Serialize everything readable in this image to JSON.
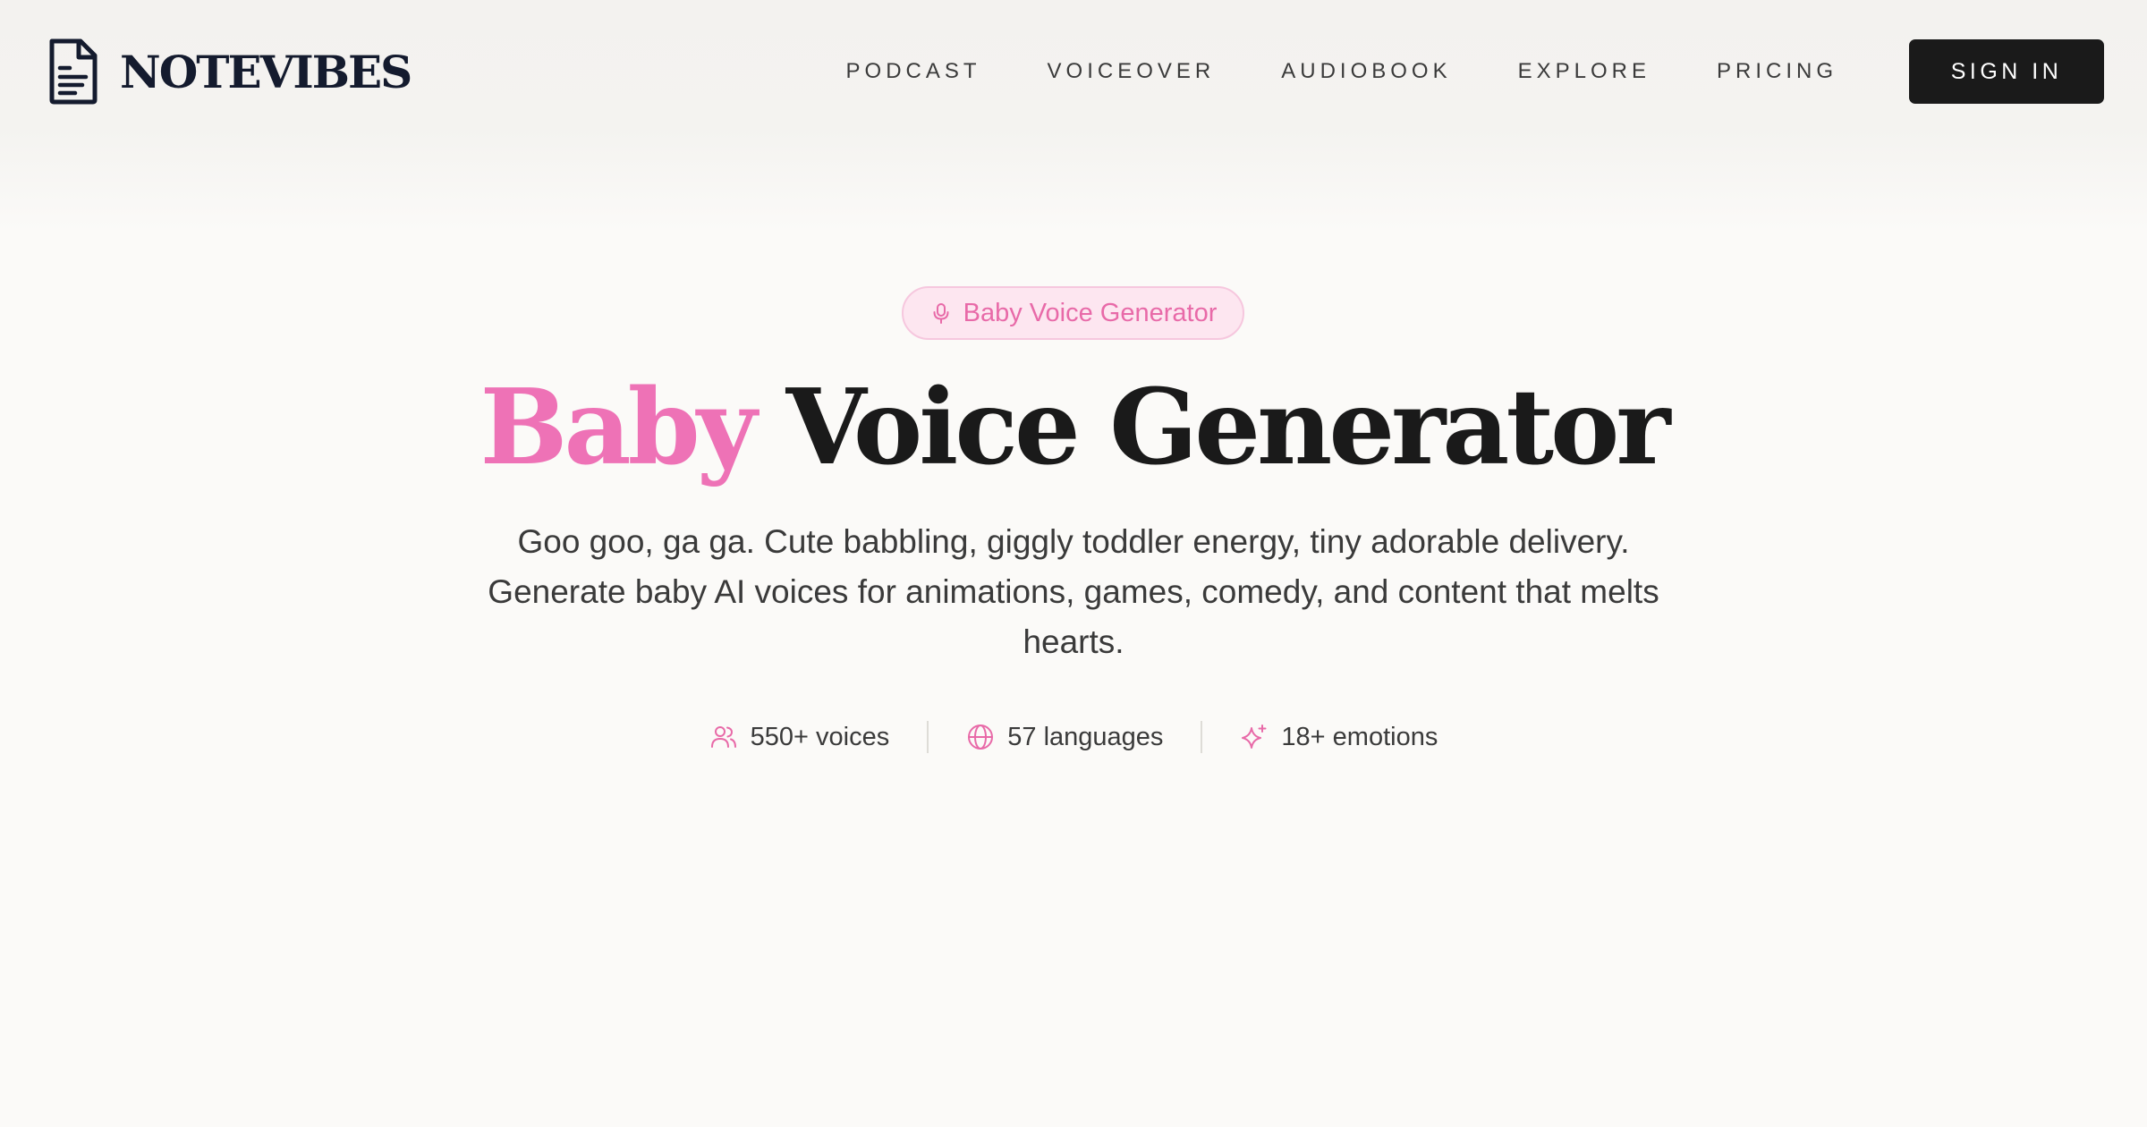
{
  "header": {
    "brand_name": "NOTEVIBES",
    "nav": [
      {
        "label": "PODCAST"
      },
      {
        "label": "VOICEOVER"
      },
      {
        "label": "AUDIOBOOK"
      },
      {
        "label": "EXPLORE"
      },
      {
        "label": "PRICING"
      }
    ],
    "signin_label": "SIGN IN"
  },
  "hero": {
    "badge_label": "Baby Voice Generator",
    "title_accent": "Baby",
    "title_rest": "Voice Generator",
    "subtitle": "Goo goo, ga ga. Cute babbling, giggly toddler energy, tiny adorable delivery. Generate baby AI voices for animations, games, comedy, and content that melts hearts.",
    "stats": [
      {
        "icon": "users-icon",
        "label": "550+ voices"
      },
      {
        "icon": "globe-icon",
        "label": "57 languages"
      },
      {
        "icon": "sparkle-icon",
        "label": "18+ emotions"
      }
    ]
  },
  "colors": {
    "accent_pink": "#ee72b6",
    "badge_bg": "#fde6f0",
    "dark": "#1a1a1a",
    "brand_navy": "#141b2e",
    "page_bg": "#fbfaf8"
  }
}
